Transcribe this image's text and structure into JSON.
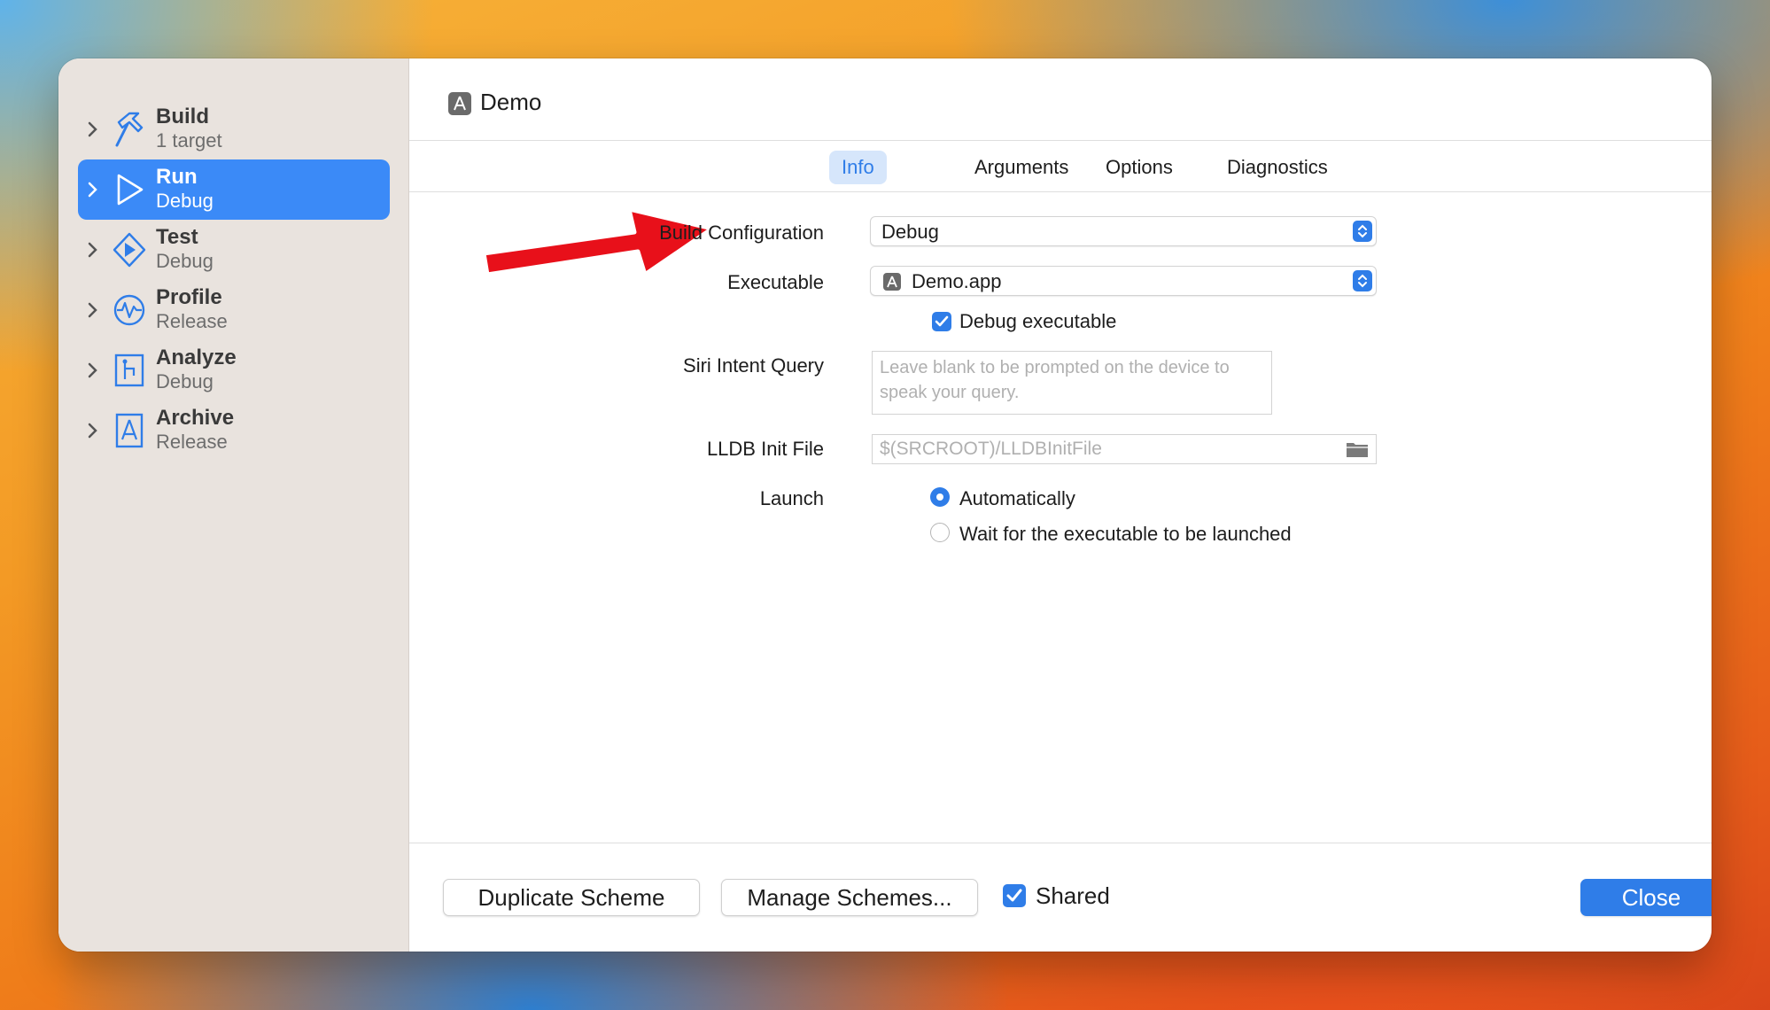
{
  "sidebar": {
    "items": [
      {
        "title": "Build",
        "subtitle": "1 target",
        "icon": "hammer-icon"
      },
      {
        "title": "Run",
        "subtitle": "Debug",
        "icon": "play-icon",
        "selected": true
      },
      {
        "title": "Test",
        "subtitle": "Debug",
        "icon": "diamond-play-icon"
      },
      {
        "title": "Profile",
        "subtitle": "Release",
        "icon": "waveform-icon"
      },
      {
        "title": "Analyze",
        "subtitle": "Debug",
        "icon": "analyze-icon"
      },
      {
        "title": "Archive",
        "subtitle": "Release",
        "icon": "app-archive-icon"
      }
    ]
  },
  "header": {
    "title": "Demo"
  },
  "tabs": [
    {
      "label": "Info",
      "active": true
    },
    {
      "label": "Arguments"
    },
    {
      "label": "Options"
    },
    {
      "label": "Diagnostics"
    }
  ],
  "form": {
    "build_configuration": {
      "label": "Build Configuration",
      "value": "Debug"
    },
    "executable": {
      "label": "Executable",
      "value": "Demo.app"
    },
    "debug_executable": {
      "label": "Debug executable",
      "checked": true
    },
    "siri_intent_query": {
      "label": "Siri Intent Query",
      "placeholder": "Leave blank to be prompted on the device to speak your query."
    },
    "lldb_init_file": {
      "label": "LLDB Init File",
      "placeholder": "$(SRCROOT)/LLDBInitFile"
    },
    "launch": {
      "label": "Launch",
      "options": [
        {
          "label": "Automatically",
          "selected": true
        },
        {
          "label": "Wait for the executable to be launched",
          "selected": false
        }
      ]
    }
  },
  "footer": {
    "duplicate_label": "Duplicate Scheme",
    "manage_label": "Manage Schemes...",
    "shared_label": "Shared",
    "shared_checked": true,
    "close_label": "Close"
  },
  "colors": {
    "accent": "#2f7de8",
    "sidebar_selected": "#3b8af7",
    "annotation_arrow": "#e8101a"
  }
}
